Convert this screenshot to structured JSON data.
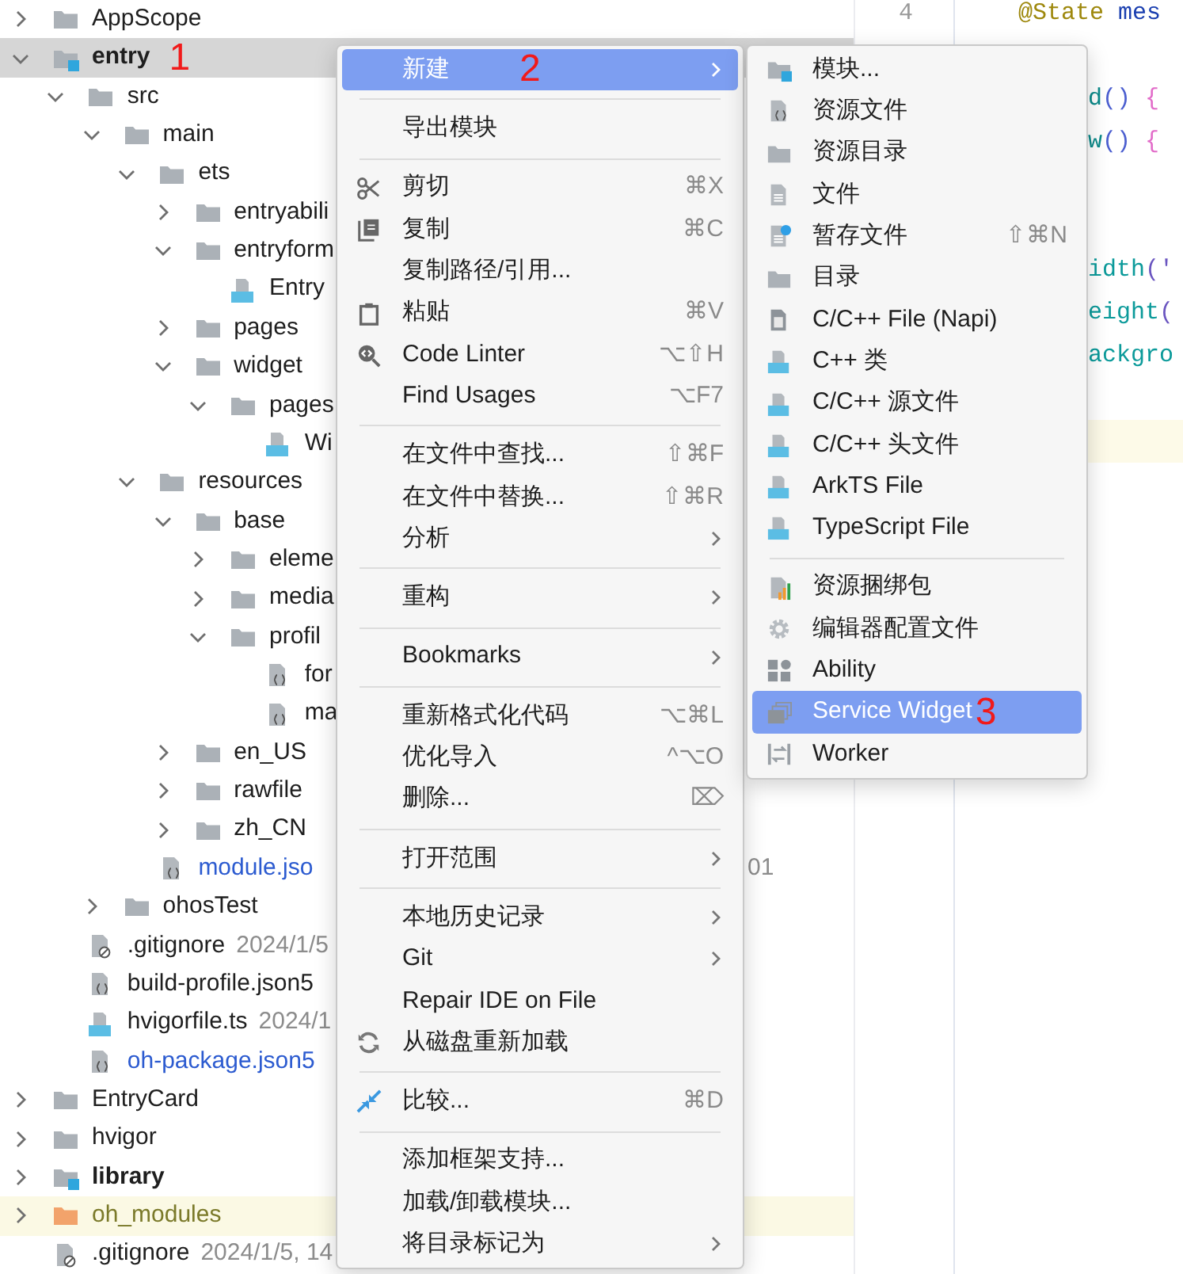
{
  "project_tree": [
    {
      "label": "AppScope",
      "kind": "folder",
      "expanded": false,
      "selected": false
    },
    {
      "label": "entry",
      "kind": "module",
      "expanded": true,
      "selected": true,
      "annotation": "1",
      "children": [
        {
          "label": "src",
          "kind": "folder",
          "expanded": true,
          "selected": false,
          "children": [
            {
              "label": "main",
              "kind": "folder",
              "expanded": true,
              "selected": false,
              "children": [
                {
                  "label": "ets",
                  "kind": "folder",
                  "expanded": true,
                  "selected": false,
                  "children": [
                    {
                      "label": "entryabili",
                      "kind": "folder",
                      "expanded": false,
                      "selected": false
                    },
                    {
                      "label": "entryform",
                      "kind": "folder",
                      "expanded": true,
                      "selected": false,
                      "children": [
                        {
                          "label": "Entry",
                          "kind": "ts",
                          "selected": false
                        }
                      ]
                    },
                    {
                      "label": "pages",
                      "kind": "folder",
                      "expanded": false,
                      "selected": false
                    },
                    {
                      "label": "widget",
                      "kind": "folder",
                      "expanded": true,
                      "selected": false,
                      "children": [
                        {
                          "label": "pages",
                          "kind": "folder",
                          "expanded": true,
                          "selected": false,
                          "children": [
                            {
                              "label": "Wi",
                              "kind": "ets",
                              "selected": false
                            }
                          ]
                        }
                      ]
                    }
                  ]
                },
                {
                  "label": "resources",
                  "kind": "folder",
                  "expanded": true,
                  "selected": false,
                  "children": [
                    {
                      "label": "base",
                      "kind": "folder",
                      "expanded": true,
                      "selected": false,
                      "children": [
                        {
                          "label": "eleme",
                          "kind": "folder",
                          "expanded": false,
                          "selected": false
                        },
                        {
                          "label": "media",
                          "kind": "folder",
                          "expanded": false,
                          "selected": false
                        },
                        {
                          "label": "profil",
                          "kind": "folder",
                          "expanded": true,
                          "selected": false,
                          "children": [
                            {
                              "label": "for",
                              "kind": "json",
                              "selected": false
                            },
                            {
                              "label": "ma",
                              "kind": "json",
                              "selected": false
                            }
                          ]
                        }
                      ]
                    },
                    {
                      "label": "en_US",
                      "kind": "folder",
                      "expanded": false,
                      "selected": false
                    },
                    {
                      "label": "rawfile",
                      "kind": "folder",
                      "expanded": false,
                      "selected": false
                    },
                    {
                      "label": "zh_CN",
                      "kind": "folder",
                      "expanded": false,
                      "selected": false
                    }
                  ]
                },
                {
                  "label": "module.jso",
                  "kind": "json",
                  "selected": false,
                  "color": "#2c5bd0",
                  "date_fragment": "01"
                }
              ]
            },
            {
              "label": "ohosTest",
              "kind": "folder",
              "expanded": false,
              "selected": false
            }
          ]
        },
        {
          "label": ".gitignore",
          "kind": "gitignore",
          "selected": false,
          "date": "2024/1/5"
        },
        {
          "label": "build-profile.json5",
          "kind": "json",
          "selected": false
        },
        {
          "label": "hvigorfile.ts",
          "kind": "ts",
          "selected": false,
          "date": "2024/1"
        },
        {
          "label": "oh-package.json5",
          "kind": "json",
          "selected": false,
          "color": "#2c5bd0"
        }
      ]
    },
    {
      "label": "EntryCard",
      "kind": "folder",
      "expanded": false,
      "selected": false
    },
    {
      "label": "hvigor",
      "kind": "folder",
      "expanded": false,
      "selected": false
    },
    {
      "label": "library",
      "kind": "module",
      "expanded": false,
      "selected": false
    },
    {
      "label": "oh_modules",
      "kind": "excluded",
      "expanded": false,
      "selected": false,
      "color": "#7b7a2a"
    },
    {
      "label": ".gitignore",
      "kind": "gitignore",
      "selected": false,
      "date": "2024/1/5, 14"
    }
  ],
  "editor": {
    "line_numbers": [
      "4"
    ],
    "lines": [
      {
        "tokens": [
          {
            "text": "@State",
            "color": "#9e880d"
          },
          {
            "text": " mes",
            "color": "#1a3fb0"
          }
        ]
      },
      {
        "cut_by_menu": true,
        "tokens": [
          {
            "text": "d",
            "color": "#0b8a8a"
          },
          {
            "text": "()",
            "color": "#4c5fd0"
          },
          {
            "text": " {",
            "color": "#e26cc9"
          }
        ]
      },
      {
        "cut_by_menu": true,
        "tokens": [
          {
            "text": "w",
            "color": "#0b8a8a"
          },
          {
            "text": "()",
            "color": "#4c5fd0"
          },
          {
            "text": " {",
            "color": "#e26cc9"
          }
        ]
      },
      {
        "cut_by_menu": true,
        "tokens": [
          {
            "text": "idth",
            "color": "#0b9a9a"
          },
          {
            "text": "('",
            "color": "#6a55c0"
          }
        ]
      },
      {
        "cut_by_menu": true,
        "tokens": [
          {
            "text": "eight",
            "color": "#0b9a9a"
          },
          {
            "text": "(",
            "color": "#6a55c0"
          }
        ]
      },
      {
        "cut_by_menu": true,
        "tokens": [
          {
            "text": "ackgro",
            "color": "#0b9a9a"
          }
        ]
      },
      {
        "current": true
      }
    ]
  },
  "context_menu": {
    "items": [
      {
        "kind": "item",
        "label": "新建",
        "submenu": true,
        "selected": true,
        "annotation": "2"
      },
      {
        "kind": "separator"
      },
      {
        "kind": "item",
        "label": "导出模块",
        "selected": false
      },
      {
        "kind": "separator"
      },
      {
        "kind": "item",
        "label": "剪切",
        "shortcut": "⌘X",
        "selected": false
      },
      {
        "kind": "item",
        "label": "复制",
        "shortcut": "⌘C",
        "selected": false
      },
      {
        "kind": "item",
        "label": "复制路径/引用...",
        "selected": false
      },
      {
        "kind": "item",
        "label": "粘贴",
        "shortcut": "⌘V",
        "selected": false
      },
      {
        "kind": "item",
        "label": "Code Linter",
        "shortcut": "⌥⇧H",
        "selected": false
      },
      {
        "kind": "item",
        "label": "Find Usages",
        "shortcut": "⌥F7",
        "selected": false
      },
      {
        "kind": "separator"
      },
      {
        "kind": "item",
        "label": "在文件中查找...",
        "shortcut": "⇧⌘F",
        "selected": false
      },
      {
        "kind": "item",
        "label": "在文件中替换...",
        "shortcut": "⇧⌘R",
        "selected": false
      },
      {
        "kind": "item",
        "label": "分析",
        "submenu": true,
        "selected": false
      },
      {
        "kind": "separator"
      },
      {
        "kind": "item",
        "label": "重构",
        "submenu": true,
        "selected": false
      },
      {
        "kind": "separator"
      },
      {
        "kind": "item",
        "label": "Bookmarks",
        "submenu": true,
        "selected": false
      },
      {
        "kind": "separator"
      },
      {
        "kind": "item",
        "label": "重新格式化代码",
        "shortcut": "⌥⌘L",
        "selected": false
      },
      {
        "kind": "item",
        "label": "优化导入",
        "shortcut": "^⌥O",
        "selected": false
      },
      {
        "kind": "item",
        "label": "删除...",
        "shortcut": "⌦",
        "selected": false
      },
      {
        "kind": "separator"
      },
      {
        "kind": "item",
        "label": "打开范围",
        "submenu": true,
        "selected": false
      },
      {
        "kind": "separator"
      },
      {
        "kind": "item",
        "label": "本地历史记录",
        "submenu": true,
        "selected": false
      },
      {
        "kind": "item",
        "label": "Git",
        "submenu": true,
        "selected": false
      },
      {
        "kind": "item",
        "label": "Repair IDE on File",
        "selected": false
      },
      {
        "kind": "item",
        "label": "从磁盘重新加载",
        "selected": false
      },
      {
        "kind": "separator"
      },
      {
        "kind": "item",
        "label": "比较...",
        "shortcut": "⌘D",
        "selected": false
      },
      {
        "kind": "separator"
      },
      {
        "kind": "item",
        "label": "添加框架支持...",
        "selected": false
      },
      {
        "kind": "item",
        "label": "加载/卸载模块...",
        "selected": false
      },
      {
        "kind": "item",
        "label": "将目录标记为",
        "submenu": true,
        "selected": false
      }
    ]
  },
  "new_submenu": {
    "items": [
      {
        "kind": "item",
        "label": "模块...",
        "selected": false
      },
      {
        "kind": "item",
        "label": "资源文件",
        "selected": false
      },
      {
        "kind": "item",
        "label": "资源目录",
        "selected": false
      },
      {
        "kind": "item",
        "label": "文件",
        "selected": false
      },
      {
        "kind": "item",
        "label": "暂存文件",
        "shortcut": "⇧⌘N",
        "selected": false
      },
      {
        "kind": "item",
        "label": "目录",
        "selected": false
      },
      {
        "kind": "item",
        "label": "C/C++ File (Napi)",
        "selected": false
      },
      {
        "kind": "item",
        "label": "C++ 类",
        "selected": false
      },
      {
        "kind": "item",
        "label": "C/C++ 源文件",
        "selected": false
      },
      {
        "kind": "item",
        "label": "C/C++ 头文件",
        "selected": false
      },
      {
        "kind": "item",
        "label": "ArkTS File",
        "selected": false
      },
      {
        "kind": "item",
        "label": "TypeScript File",
        "selected": false
      },
      {
        "kind": "separator"
      },
      {
        "kind": "item",
        "label": "资源捆绑包",
        "selected": false
      },
      {
        "kind": "item",
        "label": "编辑器配置文件",
        "selected": false
      },
      {
        "kind": "item",
        "label": "Ability",
        "selected": false
      },
      {
        "kind": "item",
        "label": "Service Widget",
        "selected": true,
        "annotation": "3"
      },
      {
        "kind": "item",
        "label": "Worker",
        "selected": false
      }
    ]
  }
}
